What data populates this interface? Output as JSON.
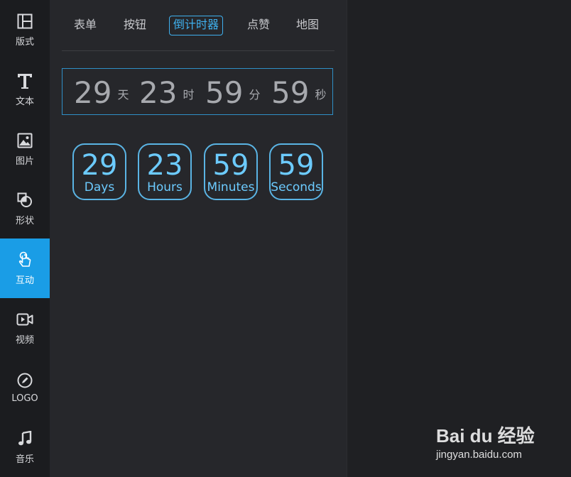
{
  "sidebar": {
    "items": [
      {
        "label": "版式",
        "icon": "layout-icon"
      },
      {
        "label": "文本",
        "icon": "text-icon"
      },
      {
        "label": "图片",
        "icon": "image-icon"
      },
      {
        "label": "形状",
        "icon": "shape-icon"
      },
      {
        "label": "互动",
        "icon": "touch-icon",
        "active": true
      },
      {
        "label": "视频",
        "icon": "video-icon"
      },
      {
        "label": "LOGO",
        "icon": "logo-pen-icon"
      },
      {
        "label": "音乐",
        "icon": "music-icon"
      }
    ]
  },
  "tabs": {
    "items": [
      {
        "label": "表单"
      },
      {
        "label": "按钮"
      },
      {
        "label": "倒计时器",
        "active": true
      },
      {
        "label": "点赞"
      },
      {
        "label": "地图"
      }
    ]
  },
  "countdown1": {
    "days": "29",
    "days_suffix": "天",
    "hours": "23",
    "hours_suffix": "时",
    "minutes": "59",
    "minutes_suffix": "分",
    "seconds": "59",
    "seconds_suffix": "秒"
  },
  "countdown2": {
    "days": "29",
    "days_label": "Days",
    "hours": "23",
    "hours_label": "Hours",
    "minutes": "59",
    "minutes_label": "Minutes",
    "seconds": "59",
    "seconds_label": "Seconds"
  },
  "watermark": {
    "brand": "Bai du 经验",
    "url": "jingyan.baidu.com"
  },
  "colors": {
    "accent": "#1a9de6",
    "countdown_blue": "#6ccbff",
    "panel_bg": "#26272b",
    "sidebar_bg": "#1b1c1f"
  }
}
